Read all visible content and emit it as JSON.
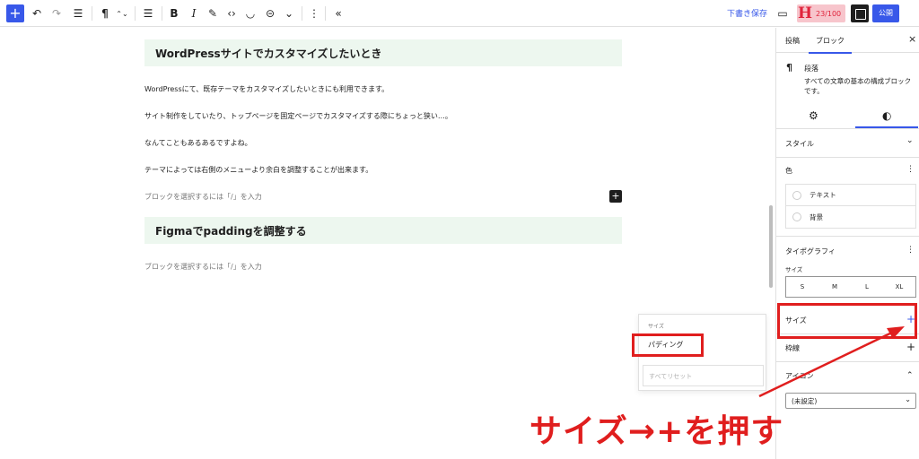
{
  "toolbar": {
    "add": "+",
    "undo": "↶",
    "redo": "↷",
    "list_view": "☰",
    "paragraph": "¶",
    "move": "⌃⌄",
    "align": "☰",
    "bold": "B",
    "italic": "I",
    "highlight": "✎",
    "code": "‹›",
    "emoji": "◡",
    "link": "⊝",
    "more_rich": "⌄",
    "options": "⋮",
    "collapse": "«",
    "draft_save": "下書き保存",
    "preview": "▭",
    "h_logo": "H",
    "count": "23/100",
    "publish": "公開"
  },
  "editor": {
    "heading1": "WordPressサイトでカスタマイズしたいとき",
    "para1": "WordPressにて、既存テーマをカスタマイズしたいときにも利用できます。",
    "para2": "サイト制作をしていたり、トップページを固定ページでカスタマイズする際にちょっと狭い…。",
    "para3": "なんてこともあるあるですよね。",
    "para4": "テーマによっては右側のメニューより余白を調整することが出来ます。",
    "placeholder1": "ブロックを選択するには「/」を入力",
    "inserter": "+",
    "heading2": "Figmaでpaddingを調整する",
    "placeholder2": "ブロックを選択するには「/」を入力"
  },
  "dropdown": {
    "heading": "サイズ",
    "item": "パディング",
    "reset": "すべてリセット"
  },
  "sidebar": {
    "tab_post": "投稿",
    "tab_block": "ブロック",
    "close": "×",
    "block_icon": "¶",
    "block_title": "段落",
    "block_desc": "すべての文章の基本の構成ブロックです。",
    "settings_icon": "⚙",
    "styles_icon": "◐",
    "style_label": "スタイル",
    "style_chev": "⌄",
    "color_label": "色",
    "color_menu": "⋮",
    "color_text": "テキスト",
    "color_bg": "背景",
    "typo_label": "タイポグラフィ",
    "typo_menu": "⋮",
    "size_label": "サイズ",
    "sizes": [
      "S",
      "M",
      "L",
      "XL"
    ],
    "dims_label": "サイズ",
    "dims_add": "+",
    "border_label": "枠線",
    "border_add": "+",
    "icon_label": "アイコン",
    "icon_chev": "⌃",
    "icon_select": "(未設定)",
    "icon_select_chev": "⌄"
  },
  "annotation": {
    "text": "サイズ→+を押す",
    "color": "#e01e1e"
  },
  "colors": {
    "accent": "#3858e9",
    "heading_bg": "#edf7ef",
    "highlight_red": "#e01e1e"
  }
}
